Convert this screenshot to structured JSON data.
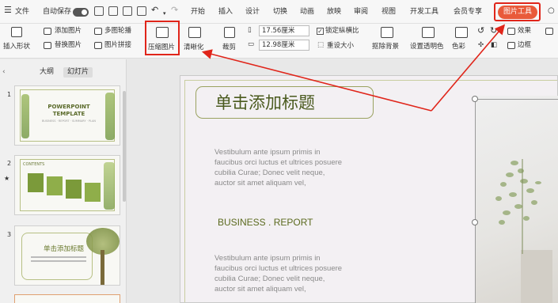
{
  "menubar": {
    "file": "文件",
    "autosave": "自动保存",
    "tabs": [
      "开始",
      "插入",
      "设计",
      "切换",
      "动画",
      "放映",
      "审阅",
      "视图",
      "开发工具",
      "会员专享"
    ],
    "picture_tools": "图片工具"
  },
  "ribbon": {
    "insert_shape": "插入形状",
    "add_picture": "添加图片",
    "multi_outline": "多图轮播",
    "replace_picture": "替换图片",
    "picture_stitch": "图片拼接",
    "compress_picture": "压缩图片",
    "sharpen": "清晰化",
    "crop": "裁剪",
    "height_value": "17.56厘米",
    "width_value": "12.98厘米",
    "lock_ratio": "锁定纵横比",
    "reset_size": "重设大小",
    "remove_bg": "抠除背景",
    "set_transparent": "设置透明色",
    "color": "色彩",
    "effects": "效果",
    "border": "边框"
  },
  "panel": {
    "tab_outline": "大纲",
    "tab_slides": "幻灯片",
    "slides": [
      {
        "num": "1",
        "title": "POWERPOINT TEMPLATE",
        "subtitle": "BUSINESS · REPORT · SUMMARY · PLAN"
      },
      {
        "num": "2",
        "title": "CONTENTS"
      },
      {
        "num": "3",
        "title": "单击添加标题"
      }
    ]
  },
  "slide": {
    "title": "单击添加标题",
    "body1": "Vestibulum ante ipsum primis in faucibus orci luctus et ultrices posuere cubilia Curae; Donec velit neque, auctor sit amet aliquam vel,",
    "heading": "BUSINESS . REPORT",
    "body2": "Vestibulum ante ipsum primis in faucibus orci luctus et ultrices posuere cubilia Curae; Donec velit neque, auctor sit amet aliquam vel,"
  },
  "colors": {
    "highlight": "#e0251a",
    "accent_tab": "#e95a3a",
    "title_green": "#4a5a1e"
  }
}
